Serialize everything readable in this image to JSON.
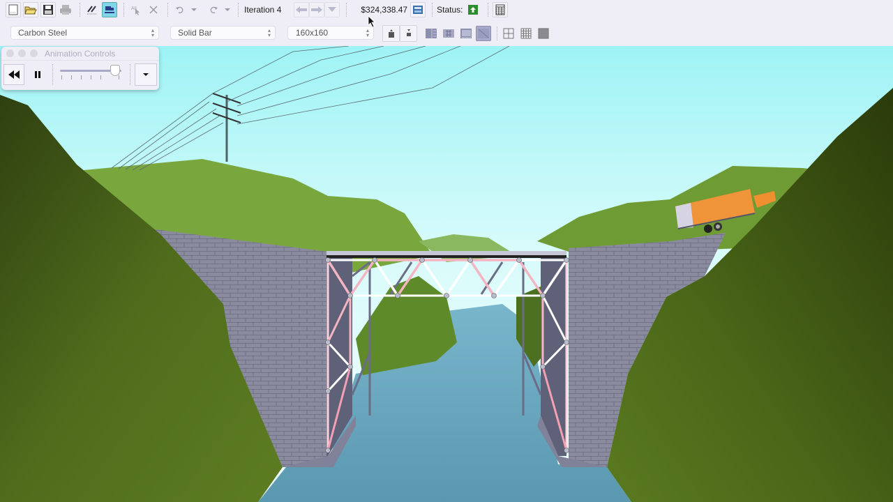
{
  "toolbar": {
    "buttons": [
      {
        "name": "new-document-button",
        "icon": "new-document-icon"
      },
      {
        "name": "open-folder-button",
        "icon": "open-folder-icon"
      },
      {
        "name": "save-button",
        "icon": "save-disk-icon"
      },
      {
        "name": "print-button",
        "icon": "printer-icon"
      },
      {
        "name": "draw-members-button",
        "icon": "draw-pencil-icon"
      },
      {
        "name": "load-test-button",
        "icon": "truck-load-test-icon"
      },
      {
        "name": "select-all-button",
        "icon": "select-all-icon"
      },
      {
        "name": "delete-button",
        "icon": "close-x-icon"
      },
      {
        "name": "undo-button",
        "icon": "undo-icon"
      },
      {
        "name": "redo-button",
        "icon": "redo-icon"
      }
    ],
    "iteration_label": "Iteration 4",
    "cost": "$324,338.47",
    "status_label": "Status:",
    "status_value": "pass",
    "status_color": "#2e8b2e"
  },
  "toolbar2": {
    "material": "Carbon Steel",
    "cross_section": "Solid Bar",
    "size": "160x160",
    "buttons": [
      "increase-size-button",
      "decrease-size-button",
      "member-list-button",
      "member-table-button",
      "member-details-button",
      "template-button",
      "coarse-grid-button",
      "medium-grid-button",
      "fine-grid-button"
    ]
  },
  "animation_controls": {
    "title": "Animation Controls",
    "speed_fraction": 0.92,
    "buttons": [
      "rewind-button",
      "pause-button",
      "options-dropdown-button"
    ]
  },
  "scene": {
    "colors": {
      "sky_top": "#9ef3f5",
      "sky_bottom": "#e4fbfb",
      "hill_near": "#4d6a1a",
      "hill_far": "#7aa63e",
      "water": "#5d9db5",
      "masonry": "#8a8a9e",
      "truss_tension": "#f0a6b6",
      "truss_compression": "#ffffff",
      "truss_steel": "#6a6d86",
      "truck": "#ef9438"
    }
  }
}
